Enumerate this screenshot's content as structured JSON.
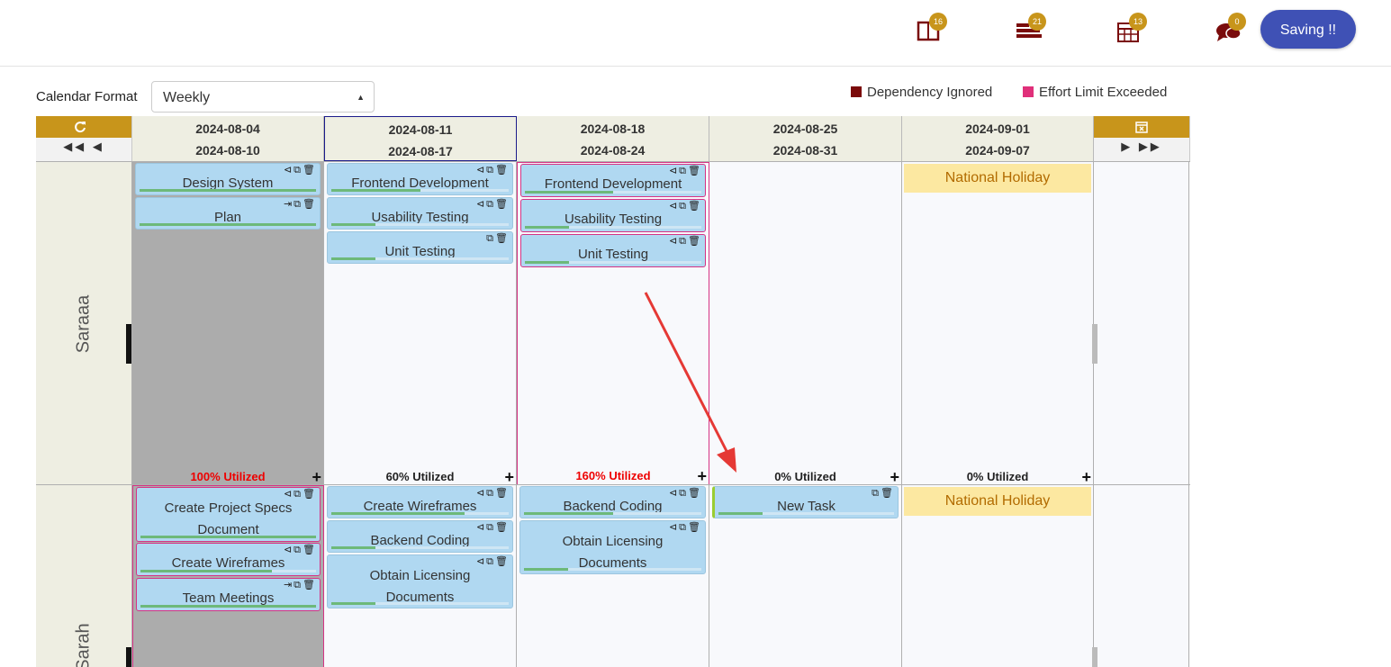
{
  "topbar": {
    "icons": [
      {
        "name": "book-icon",
        "badge": "16"
      },
      {
        "name": "list-icon",
        "badge": "21"
      },
      {
        "name": "calendar-icon",
        "badge": "13"
      },
      {
        "name": "chat-icon",
        "badge": "0"
      }
    ],
    "saving_label": "Saving !!"
  },
  "calendar_format": {
    "label": "Calendar Format",
    "value": "Weekly"
  },
  "legend": [
    {
      "label": "Dependency Ignored",
      "color": "#7b0a0a"
    },
    {
      "label": "Effort Limit Exceeded",
      "color": "#e0307a"
    }
  ],
  "weeks": [
    {
      "start": "2024-08-04",
      "end": "2024-08-10"
    },
    {
      "start": "2024-08-11",
      "end": "2024-08-17"
    },
    {
      "start": "2024-08-18",
      "end": "2024-08-24"
    },
    {
      "start": "2024-08-25",
      "end": "2024-08-31"
    },
    {
      "start": "2024-09-01",
      "end": "2024-09-07"
    }
  ],
  "rows": [
    {
      "name": "Saraaa",
      "cells": [
        {
          "tasks": [
            "Design System",
            "Plan"
          ],
          "util": "100% Utilized"
        },
        {
          "tasks": [
            "Frontend Development",
            "Usability Testing",
            "Unit Testing"
          ],
          "util": "60% Utilized"
        },
        {
          "tasks": [
            "Frontend Development",
            "Usability Testing",
            "Unit Testing"
          ],
          "util": "160% Utilized"
        },
        {
          "tasks": [],
          "util": "0% Utilized"
        },
        {
          "holiday": "National Holiday",
          "util": "0% Utilized"
        }
      ]
    },
    {
      "name": "Sarah",
      "cells": [
        {
          "tasks": [
            "Create Project Specs Document",
            "Create Wireframes",
            "Team Meetings"
          ]
        },
        {
          "tasks": [
            "Create Wireframes",
            "Backend Coding",
            "Obtain Licensing Documents"
          ]
        },
        {
          "tasks": [
            "Backend Coding",
            "Obtain Licensing Documents"
          ]
        },
        {
          "tasks": [
            "New Task"
          ]
        },
        {
          "holiday": "National Holiday"
        }
      ]
    }
  ],
  "actions_icons": [
    "dependency-icon",
    "copy-icon",
    "trash-icon"
  ],
  "annotation": {
    "color": "#e53935"
  }
}
